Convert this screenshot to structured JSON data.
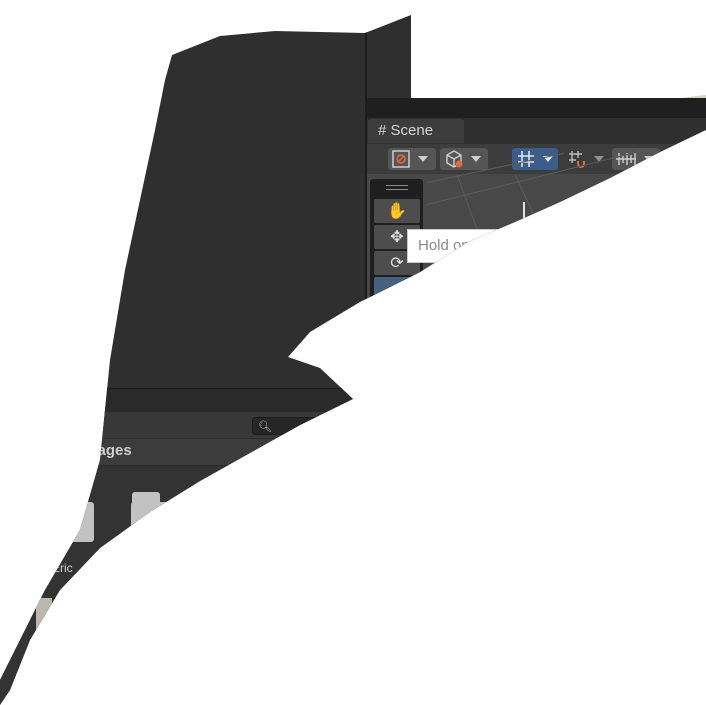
{
  "scene": {
    "tab_label": "Scene",
    "tab_icon": "grid-hash-icon",
    "tooltip": "Hold on"
  },
  "project": {
    "search_icon": "search-icon",
    "breadcrumb": "Images",
    "folders": [
      {
        "label": "Eric"
      },
      {
        "label": ""
      }
    ]
  },
  "colors": {
    "editor_bg": "#2f2f2f",
    "active_blue": "#3a5d8a",
    "folder": "#c2c2c2"
  }
}
